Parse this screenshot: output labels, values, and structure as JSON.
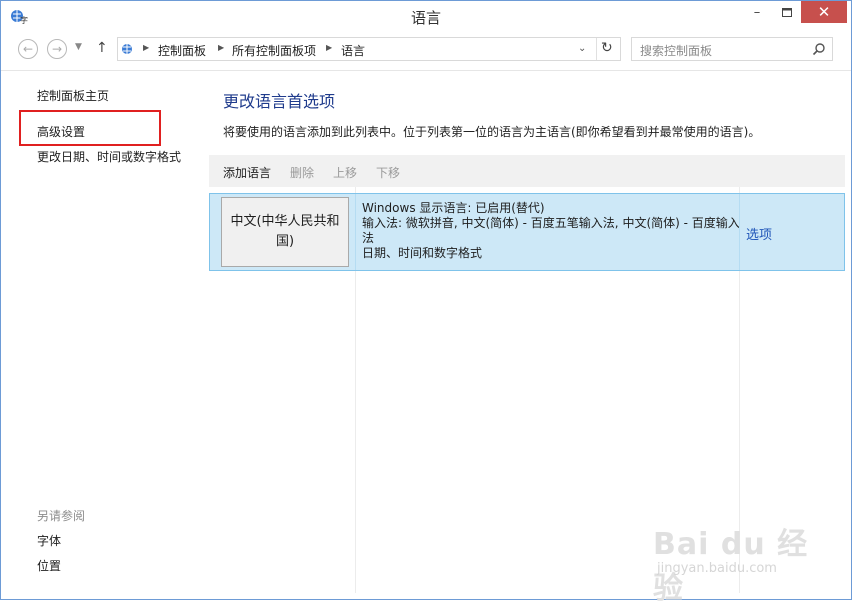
{
  "window": {
    "title": "语言",
    "minimize": "–",
    "close": "✕"
  },
  "nav": {
    "breadcrumbs": [
      "控制面板",
      "所有控制面板项",
      "语言"
    ],
    "search_placeholder": "搜索控制面板"
  },
  "sidebar": {
    "home": "控制面板主页",
    "advanced": "高级设置",
    "datetime": "更改日期、时间或数字格式",
    "see_also": "另请参阅",
    "fonts": "字体",
    "location": "位置"
  },
  "main": {
    "title": "更改语言首选项",
    "description": "将要使用的语言添加到此列表中。位于列表第一位的语言为主语言(即你希望看到并最常使用的语言)。",
    "toolbar": {
      "add": "添加语言",
      "remove": "删除",
      "up": "上移",
      "down": "下移"
    },
    "languages": [
      {
        "name": "中文(中华人民共和国)",
        "display": "Windows 显示语言: 已启用(替代)",
        "input": "输入法: 微软拼音, 中文(简体) - 百度五笔输入法, 中文(简体) - 百度输入法",
        "format": "日期、时间和数字格式",
        "options": "选项"
      }
    ]
  },
  "watermark": {
    "main": "Bai du 经验",
    "sub": "jingyan.baidu.com"
  },
  "colors": {
    "accent": "#1f3b8c",
    "link": "#1f55b8",
    "selected_row": "#cde8f7",
    "close_button": "#c7504d",
    "highlight": "#e02020"
  }
}
